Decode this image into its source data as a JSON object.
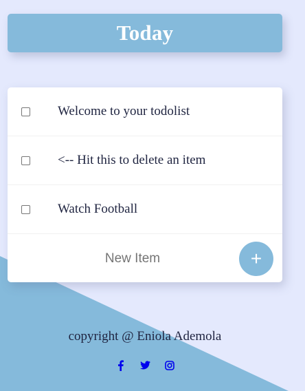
{
  "page": {
    "colors": {
      "background": "#E4E9FD",
      "accent": "#85BADB",
      "card": "#FFFFFF",
      "text": "#1F2440",
      "social_icons": "#0000EE"
    }
  },
  "header": {
    "title": "Today"
  },
  "todo": {
    "items": [
      {
        "label": "Welcome to your todolist",
        "checked": false
      },
      {
        "label": "<-- Hit this to delete an item",
        "checked": false
      },
      {
        "label": "Watch Football",
        "checked": false
      }
    ],
    "new_item": {
      "placeholder": "New Item",
      "value": ""
    },
    "add_button": {
      "label": "+"
    }
  },
  "footer": {
    "copyright": "copyright @ Eniola Ademola",
    "socials": [
      {
        "icon": "facebook-icon"
      },
      {
        "icon": "twitter-icon"
      },
      {
        "icon": "instagram-icon"
      }
    ]
  }
}
